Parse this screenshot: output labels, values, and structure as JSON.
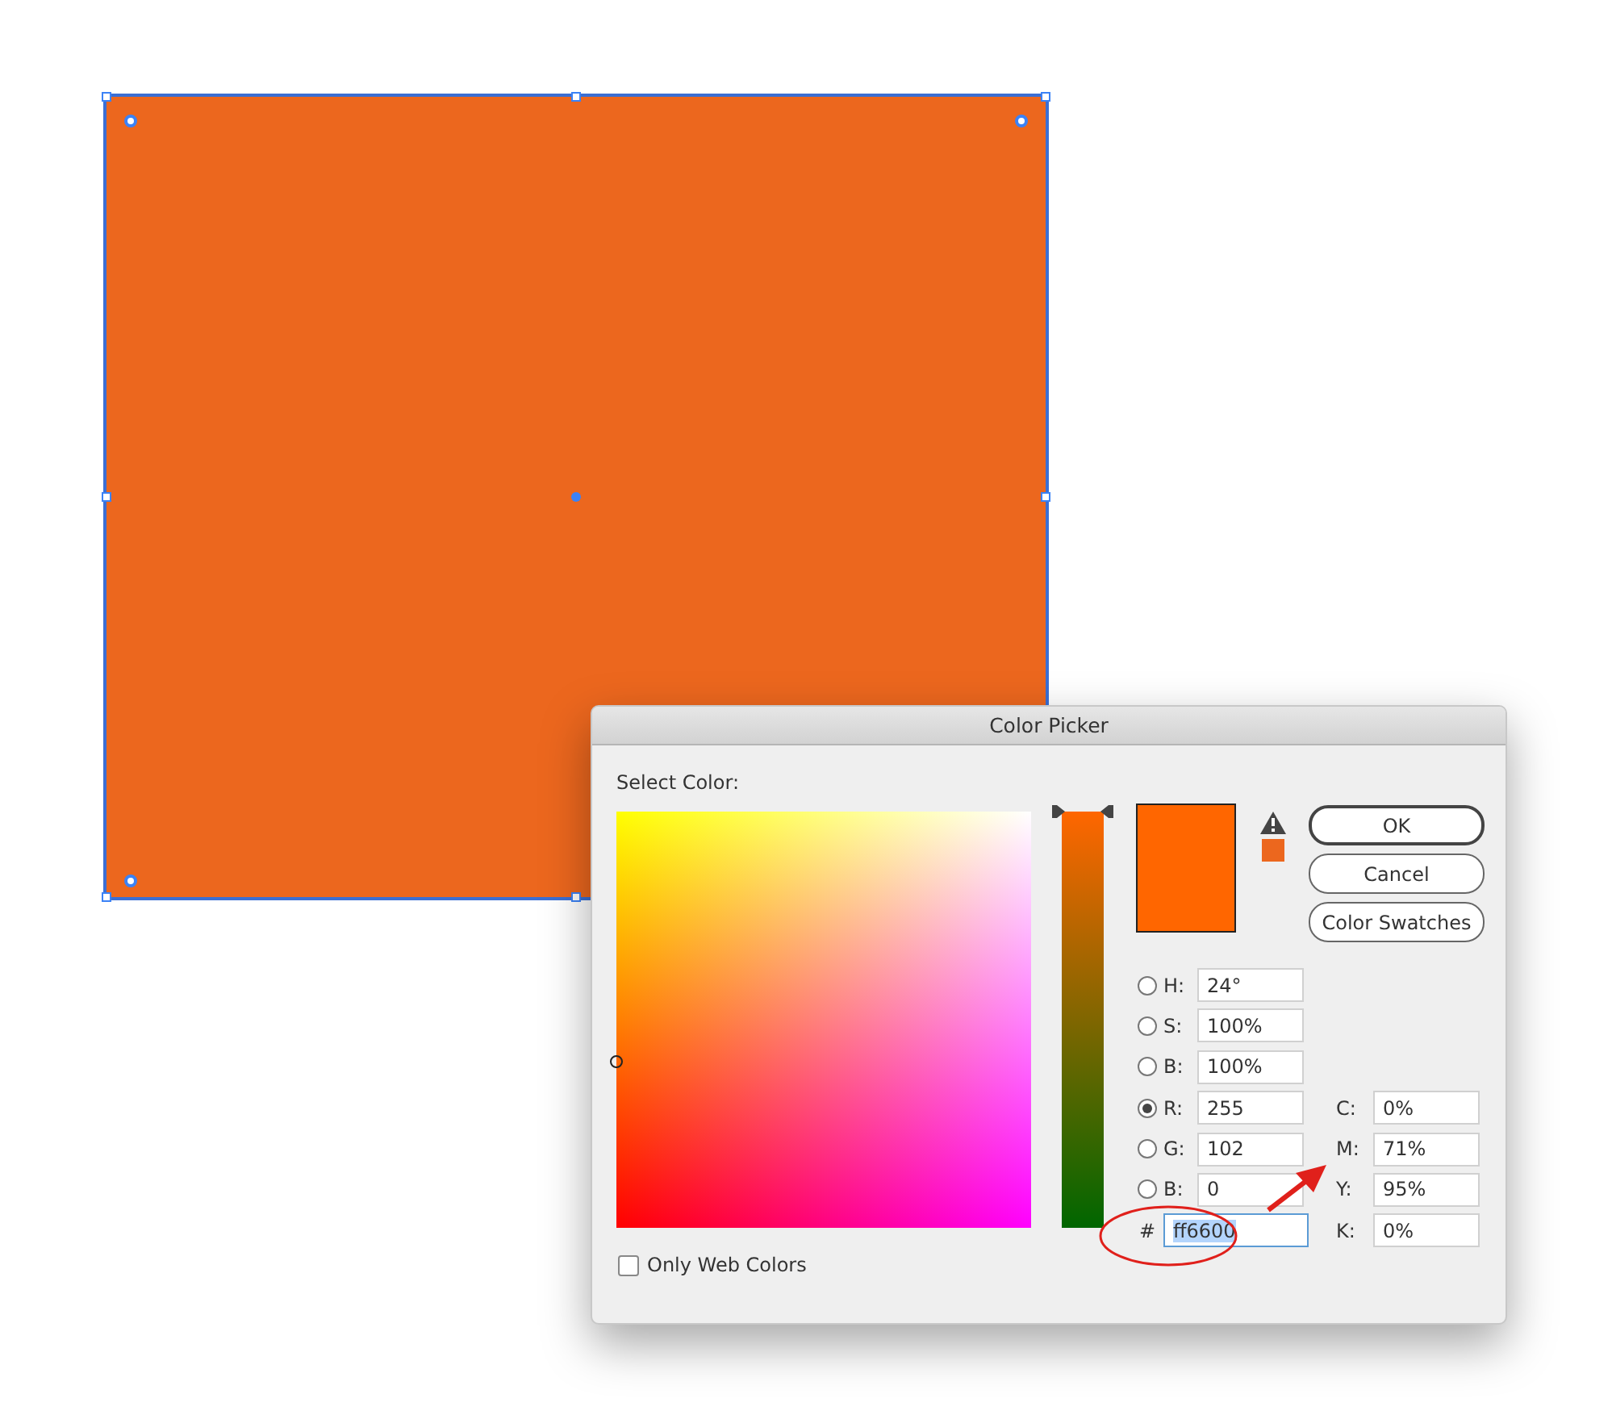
{
  "canvas": {
    "rectangle": {
      "selected": true
    }
  },
  "dialog": {
    "title": "Color Picker",
    "select_label": "Select Color:",
    "buttons": [
      {
        "label": "OK",
        "default": true
      },
      {
        "label": "Cancel",
        "default": false
      },
      {
        "label": "Color Swatches",
        "default": false
      }
    ],
    "channels": [
      {
        "label": "H:",
        "value": "24°",
        "selected": false
      },
      {
        "label": "S:",
        "value": "100%",
        "selected": false
      },
      {
        "label": "B:",
        "value": "100%",
        "selected": false
      },
      {
        "label": "R:",
        "value": "255",
        "selected": true
      },
      {
        "label": "G:",
        "value": "102",
        "selected": false
      },
      {
        "label": "B:",
        "value": "0",
        "selected": false
      }
    ],
    "slider": {
      "level": 1
    },
    "hex": {
      "label": "#",
      "value": "ff6600",
      "highlighted": true
    },
    "cmyk": [
      {
        "label": "C:",
        "value": "0%"
      },
      {
        "label": "M:",
        "value": "71%"
      },
      {
        "label": "Y:",
        "value": "95%"
      },
      {
        "label": "K:",
        "value": "0%"
      }
    ],
    "only_web_colors": {
      "label": "Only Web Colors",
      "checked": false
    }
  }
}
